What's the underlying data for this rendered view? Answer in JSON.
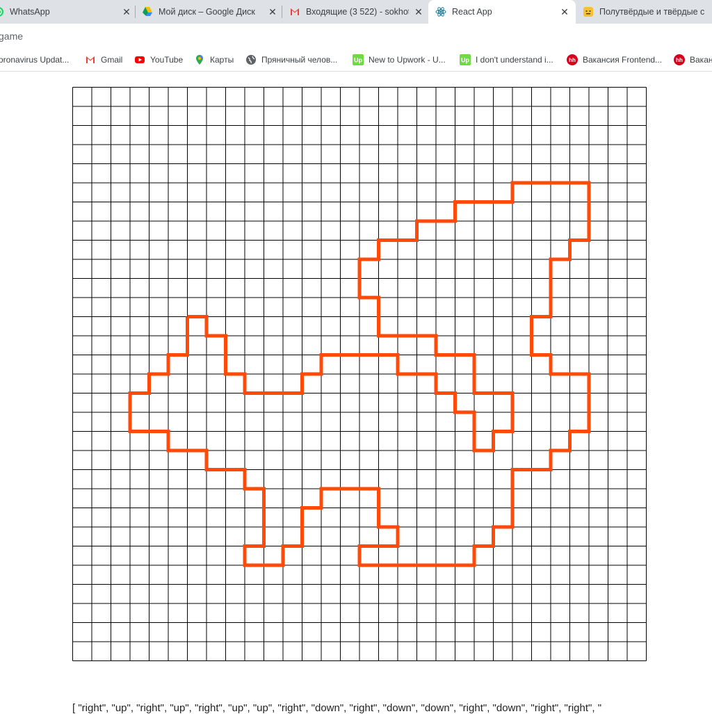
{
  "browser": {
    "tabs": [
      {
        "title": "WhatsApp",
        "icon": "whatsapp-icon",
        "active": false
      },
      {
        "title": "Мой диск – Google Диск",
        "icon": "google-drive-icon",
        "active": false
      },
      {
        "title": "Входящие (3 522) - sokhot",
        "icon": "gmail-icon",
        "active": false
      },
      {
        "title": "React App",
        "icon": "react-icon",
        "active": true
      },
      {
        "title": "Полутвёрдые и твёрдые с",
        "icon": "emoji-icon",
        "active": false
      }
    ],
    "address": "game",
    "bookmarks": [
      {
        "label": "oronavirus Updat...",
        "icon": "none"
      },
      {
        "label": "Gmail",
        "icon": "gmail-icon"
      },
      {
        "label": "YouTube",
        "icon": "youtube-icon"
      },
      {
        "label": "Карты",
        "icon": "maps-pin-icon"
      },
      {
        "label": "Пряничный челов...",
        "icon": "globe-icon"
      },
      {
        "label": "New to Upwork - U...",
        "icon": "upwork-icon"
      },
      {
        "label": "I don't understand i...",
        "icon": "upwork-icon"
      },
      {
        "label": "Вакансия Frontend...",
        "icon": "hh-icon"
      },
      {
        "label": "Вакан",
        "icon": "hh-icon"
      }
    ]
  },
  "game": {
    "grid": {
      "cols": 30,
      "rows": 30
    },
    "line_color": "#ff4a0a",
    "grid_color": "#000000",
    "path_cells": [
      [
        16,
        20
      ],
      [
        17,
        20
      ],
      [
        17,
        19
      ],
      [
        18,
        18
      ],
      [
        16,
        23
      ],
      [
        15,
        23
      ],
      [
        15,
        25
      ],
      [
        18,
        11
      ],
      [
        19,
        10
      ],
      [
        19,
        9
      ],
      [
        21,
        9
      ],
      [
        22,
        8
      ],
      [
        25,
        8
      ],
      [
        26,
        7
      ],
      [
        28,
        7
      ],
      [
        28,
        10
      ],
      [
        27,
        10
      ],
      [
        27,
        11
      ],
      [
        26,
        11
      ],
      [
        26,
        14
      ],
      [
        25,
        14
      ],
      [
        25,
        16
      ],
      [
        26,
        16
      ],
      [
        26,
        18
      ],
      [
        28,
        18
      ],
      [
        28,
        20
      ],
      [
        27,
        20
      ],
      [
        27,
        21
      ],
      [
        26,
        21
      ],
      [
        26,
        22
      ],
      [
        23,
        22
      ],
      [
        23,
        23
      ],
      [
        22,
        25
      ],
      [
        21,
        25
      ],
      [
        21,
        26
      ],
      [
        15,
        26
      ],
      [
        16,
        27
      ],
      [
        10,
        27
      ],
      [
        12,
        27
      ]
    ],
    "moves_text": "[ \"right\", \"up\", \"right\", \"up\", \"right\", \"up\", \"up\", \"right\", \"down\", \"right\", \"down\", \"down\", \"right\", \"down\", \"right\", \"right\", \""
  }
}
